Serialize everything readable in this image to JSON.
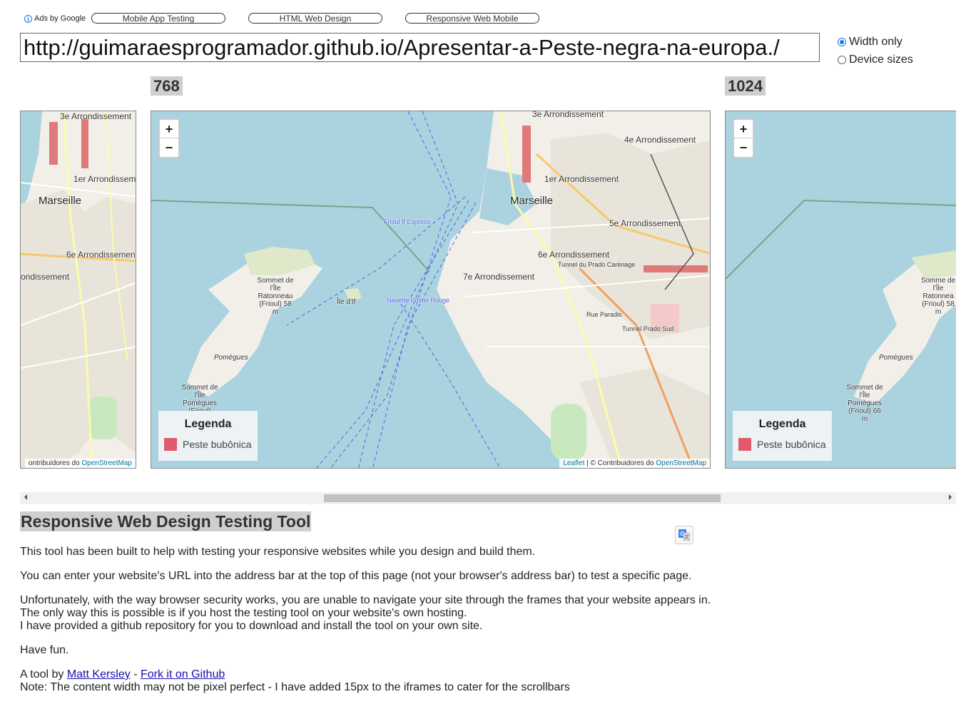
{
  "ads": {
    "label": "Ads by Google",
    "buttons": [
      "Mobile App Testing",
      "HTML Web Design",
      "Responsive Web Mobile"
    ]
  },
  "url_bar": {
    "value": "http://guimaraesprogramador.github.io/Apresentar-a-Peste-negra-na-europa./"
  },
  "mode": {
    "options": [
      "Width only",
      "Device sizes"
    ],
    "selected": "Width only"
  },
  "frames": {
    "sizes": [
      "768",
      "1024"
    ]
  },
  "map": {
    "zoom_in": "+",
    "zoom_out": "−",
    "legend_title": "Legenda",
    "legend_item": "Peste bubônica",
    "legend_color": "#e05a6c",
    "attribution_leaflet": "Leaflet",
    "attribution_sep": " | © Contribuidores do ",
    "attribution_partial": "ontribuidores do ",
    "attribution_osm": "OpenStreetMap",
    "labels": {
      "arr3": "3e Arrondissement",
      "arr4": "4e Arrondissement",
      "arr1": "1er Arrondissement",
      "marseille": "Marseille",
      "arr5": "5e Arrondissement",
      "arr6": "6e Arrondissement",
      "arr7": "7e Arrondissement",
      "arr_partial": "ondissement",
      "sommet_ratonneau": "Sommet de l'Île Ratonneau (Frioul) 58 m",
      "sommet_pomegues": "Sommet de l'Île Pomègues (Frioul)",
      "sommet_pomegues_full": "Sommet de l'Île Pomègues (Frioul) 66 m",
      "ratonneau_partial": "Somme de l'Île Ratonnea (Frioul) 58 m",
      "pomegues": "Pomègues",
      "ile_dif": "Île d'If",
      "frioul_express": "Frioul If Express",
      "navette": "Navette Pointe Rouge",
      "tunnel": "Tunnel du Prado Carénage",
      "rue_paradis": "Rue Paradis",
      "tunnel_prado_sud": "Tunnel Prado Sud"
    }
  },
  "content": {
    "title": "Responsive Web Design Testing Tool",
    "p1": "This tool has been built to help with testing your responsive websites while you design and build them.",
    "p2": "You can enter your website's URL into the address bar at the top of this page (not your browser's address bar) to test a specific page.",
    "p3a": "Unfortunately, with the way browser security works, you are unable to navigate your site through the frames that your website appears in.",
    "p3b": "The only way this is possible is if you host the testing tool on your website's own hosting.",
    "p3c": "I have provided a github repository for you to download and install the tool on your own site.",
    "p4": "Have fun.",
    "credit_prefix": "A tool by ",
    "author": "Matt Kersley",
    "credit_sep": " - ",
    "fork": "Fork it on Github",
    "note": "Note: The content width may not be pixel perfect - I have added 15px to the iframes to cater for the scrollbars"
  }
}
